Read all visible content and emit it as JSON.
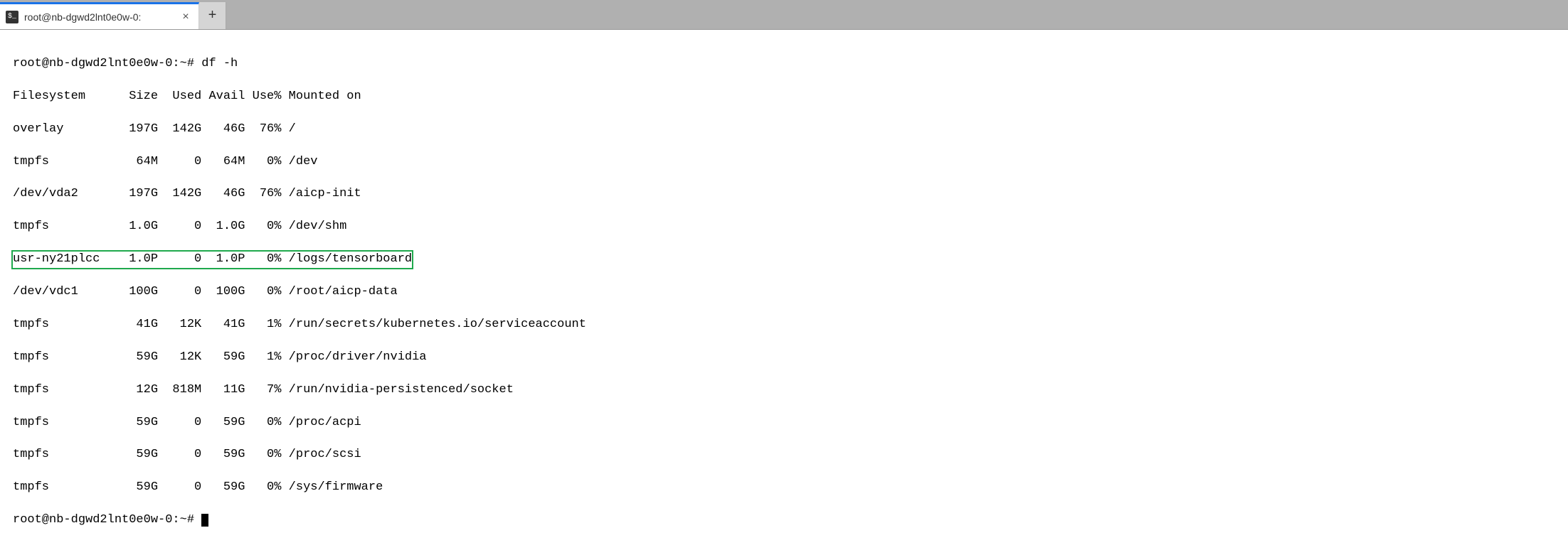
{
  "tab": {
    "title": "root@nb-dgwd2lnt0e0w-0:",
    "close_glyph": "×",
    "add_glyph": "+",
    "icon_glyph": "$_"
  },
  "terminal": {
    "prompt": "root@nb-dgwd2lnt0e0w-0:~#",
    "command": "df -h",
    "header": "Filesystem      Size  Used Avail Use% Mounted on",
    "rows": [
      {
        "fs": "overlay",
        "size": "197G",
        "used": "142G",
        "avail": "46G",
        "usep": "76%",
        "mount": "/",
        "highlighted": false
      },
      {
        "fs": "tmpfs",
        "size": "64M",
        "used": "0",
        "avail": "64M",
        "usep": "0%",
        "mount": "/dev",
        "highlighted": false
      },
      {
        "fs": "/dev/vda2",
        "size": "197G",
        "used": "142G",
        "avail": "46G",
        "usep": "76%",
        "mount": "/aicp-init",
        "highlighted": false
      },
      {
        "fs": "tmpfs",
        "size": "1.0G",
        "used": "0",
        "avail": "1.0G",
        "usep": "0%",
        "mount": "/dev/shm",
        "highlighted": false
      },
      {
        "fs": "usr-ny21plcc",
        "size": "1.0P",
        "used": "0",
        "avail": "1.0P",
        "usep": "0%",
        "mount": "/logs/tensorboard",
        "highlighted": true
      },
      {
        "fs": "/dev/vdc1",
        "size": "100G",
        "used": "0",
        "avail": "100G",
        "usep": "0%",
        "mount": "/root/aicp-data",
        "highlighted": false
      },
      {
        "fs": "tmpfs",
        "size": "41G",
        "used": "12K",
        "avail": "41G",
        "usep": "1%",
        "mount": "/run/secrets/kubernetes.io/serviceaccount",
        "highlighted": false
      },
      {
        "fs": "tmpfs",
        "size": "59G",
        "used": "12K",
        "avail": "59G",
        "usep": "1%",
        "mount": "/proc/driver/nvidia",
        "highlighted": false
      },
      {
        "fs": "tmpfs",
        "size": "12G",
        "used": "818M",
        "avail": "11G",
        "usep": "7%",
        "mount": "/run/nvidia-persistenced/socket",
        "highlighted": false
      },
      {
        "fs": "tmpfs",
        "size": "59G",
        "used": "0",
        "avail": "59G",
        "usep": "0%",
        "mount": "/proc/acpi",
        "highlighted": false
      },
      {
        "fs": "tmpfs",
        "size": "59G",
        "used": "0",
        "avail": "59G",
        "usep": "0%",
        "mount": "/proc/scsi",
        "highlighted": false
      },
      {
        "fs": "tmpfs",
        "size": "59G",
        "used": "0",
        "avail": "59G",
        "usep": "0%",
        "mount": "/sys/firmware",
        "highlighted": false
      }
    ]
  }
}
